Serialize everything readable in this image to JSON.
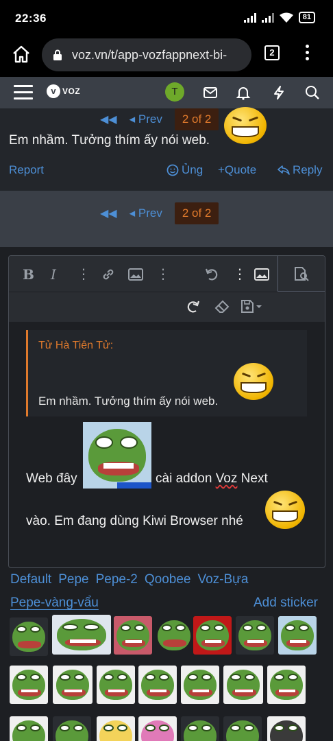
{
  "status": {
    "time": "22:36",
    "battery": "81"
  },
  "browser": {
    "url": "voz.vn/t/app-vozfappnext-bi-",
    "tab_count": "2"
  },
  "nav": {
    "avatar_letter": "T"
  },
  "post": {
    "pager": {
      "prev": "Prev",
      "current": "2 of 2"
    },
    "text": "Em nhầm. Tưởng thím ấy nói web.",
    "actions": {
      "report": "Report",
      "react": "Ủng",
      "quote": "+Quote",
      "reply": "Reply"
    }
  },
  "pager_bottom": {
    "prev": "Prev",
    "current": "2 of 2"
  },
  "editor": {
    "quote_author": "Tử Hà Tiên Tử:",
    "quote_text": "Em nhầm. Tưởng thím ấy nói web.",
    "line1_a": "Web đây",
    "line1_b": "cài addon ",
    "line1_misspelled": "Voz",
    "line1_c": " Next",
    "line2": "vào. Em đang dùng Kiwi Browser nhé"
  },
  "sticker_tabs": [
    "Default",
    "Pepe",
    "Pepe-2",
    "Qoobee",
    "Voz-Bựa"
  ],
  "sticker_tab_active": "Pepe-vàng-vẩu",
  "add_sticker": "Add sticker",
  "colors": {
    "accent_blue": "#4d8fd6",
    "accent_orange": "#e07a2c",
    "nav_bg": "#3a3f47",
    "avatar_green": "#6ea92a"
  }
}
